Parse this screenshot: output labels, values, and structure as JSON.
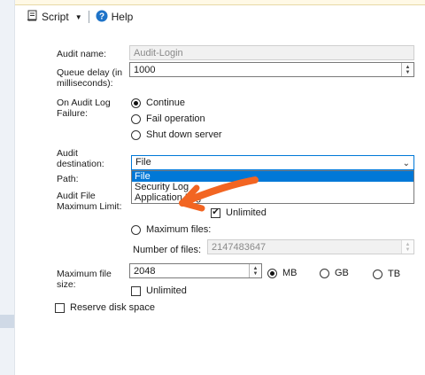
{
  "toolbar": {
    "script_label": "Script",
    "help_label": "Help"
  },
  "form": {
    "audit_name": {
      "label": "Audit name:",
      "value": "Audit-Login"
    },
    "queue_delay": {
      "label": "Queue delay (in\nmilliseconds):",
      "value": "1000"
    },
    "on_failure": {
      "label": "On Audit Log\nFailure:",
      "options": [
        "Continue",
        "Fail operation",
        "Shut down server"
      ],
      "selected": "Continue"
    },
    "audit_destination": {
      "label": "Audit\ndestination:",
      "value": "File",
      "dropdown_options": [
        "File",
        "Security Log",
        "Application Log"
      ],
      "highlighted": "File"
    },
    "path": {
      "label": "Path:"
    },
    "max_limit": {
      "label": "Audit File\nMaximum Limit:",
      "unlimited_label": "Unlimited",
      "unlimited_checked": true,
      "max_files_label": "Maximum files:",
      "number_of_files_label": "Number of files:",
      "number_of_files_value": "2147483647"
    },
    "max_file_size": {
      "label": "Maximum file\nsize:",
      "value": "2048",
      "units": [
        "MB",
        "GB",
        "TB"
      ],
      "selected_unit": "MB",
      "unlimited_label": "Unlimited",
      "unlimited_checked": false
    },
    "reserve_disk_space": {
      "label": "Reserve disk space",
      "checked": false
    }
  },
  "colors": {
    "accent": "#0078d7",
    "annotation_arrow": "#f26522"
  }
}
